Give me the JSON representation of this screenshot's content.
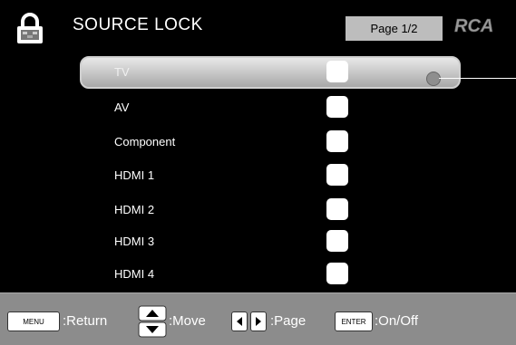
{
  "header": {
    "title": "SOURCE LOCK",
    "page_indicator": "Page 1/2",
    "brand": "RCA"
  },
  "list": {
    "items": [
      {
        "label": "TV",
        "selected": true,
        "locked": false
      },
      {
        "label": "AV",
        "selected": false,
        "locked": false
      },
      {
        "label": "Component",
        "selected": false,
        "locked": false
      },
      {
        "label": "HDMI 1",
        "selected": false,
        "locked": false
      },
      {
        "label": "HDMI 2",
        "selected": false,
        "locked": false
      },
      {
        "label": "HDMI 3",
        "selected": false,
        "locked": false
      },
      {
        "label": "HDMI 4",
        "selected": false,
        "locked": false
      }
    ]
  },
  "footer": {
    "menu_key": "MENU",
    "menu_hint": ":Return",
    "move_hint": ":Move",
    "page_hint": ":Page",
    "enter_key": "ENTER",
    "enter_hint": ":On/Off"
  },
  "colors": {
    "background": "#000000",
    "footer": "#8c8c8c",
    "page_box": "#bdbdbd",
    "checkbox": "#ffffff"
  }
}
